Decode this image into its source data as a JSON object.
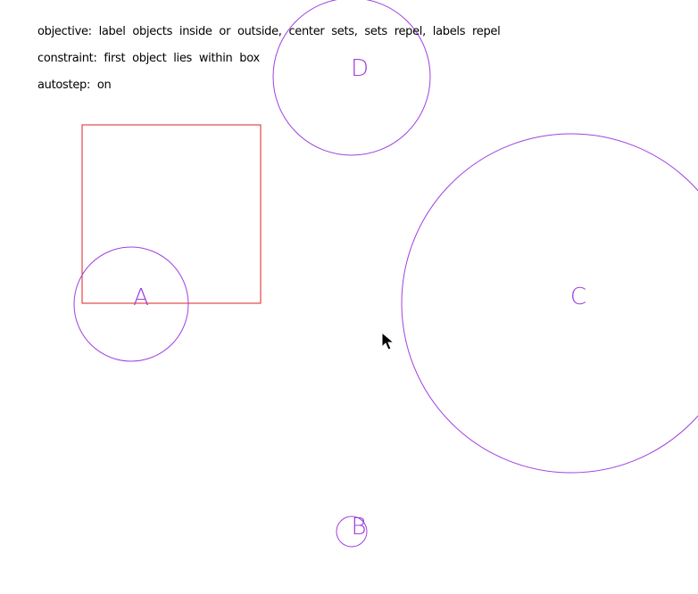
{
  "status": {
    "objective": "objective: label objects inside or outside, center sets, sets repel, labels repel",
    "constraint": "constraint: first object lies within box",
    "autostep": "autostep: on"
  },
  "colors": {
    "circle_stroke": "#a040e0",
    "box_stroke": "#e02020",
    "label_fill": "#a040e0",
    "text": "#000000",
    "background": "#ffffff"
  },
  "box": {
    "name": "constraint-box"
  },
  "sets": [
    {
      "label": "A"
    },
    {
      "label": "B"
    },
    {
      "label": "C"
    },
    {
      "label": "D"
    }
  ],
  "cursor": {
    "icon": "mouse-pointer-icon"
  }
}
